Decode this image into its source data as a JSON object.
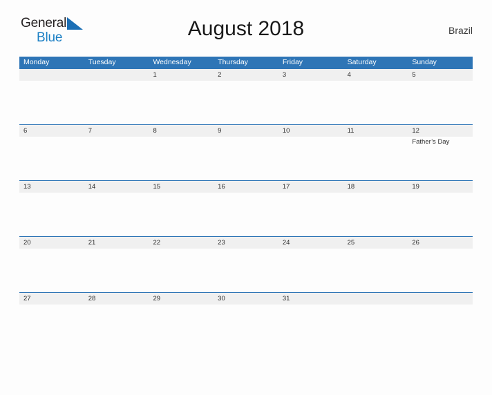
{
  "logo": {
    "text_top": "General",
    "text_bottom": "Blue",
    "mark": "blue-triangle-flag",
    "color_top": "#231f20",
    "color_bottom": "#1b7fc4"
  },
  "header": {
    "title": "August 2018",
    "country": "Brazil"
  },
  "colors": {
    "header_bar": "#2e75b6",
    "date_band": "#f0f0f0",
    "rule": "#2e75b6",
    "page_background": "#fdfdfd",
    "text": "#2b2b2b"
  },
  "calendar": {
    "weekday_headers": [
      "Monday",
      "Tuesday",
      "Wednesday",
      "Thursday",
      "Friday",
      "Saturday",
      "Sunday"
    ],
    "weeks": [
      {
        "days": [
          {
            "num": "",
            "events": []
          },
          {
            "num": "",
            "events": []
          },
          {
            "num": "1",
            "events": []
          },
          {
            "num": "2",
            "events": []
          },
          {
            "num": "3",
            "events": []
          },
          {
            "num": "4",
            "events": []
          },
          {
            "num": "5",
            "events": []
          }
        ]
      },
      {
        "days": [
          {
            "num": "6",
            "events": []
          },
          {
            "num": "7",
            "events": []
          },
          {
            "num": "8",
            "events": []
          },
          {
            "num": "9",
            "events": []
          },
          {
            "num": "10",
            "events": []
          },
          {
            "num": "11",
            "events": []
          },
          {
            "num": "12",
            "events": [
              "Father’s Day"
            ]
          }
        ]
      },
      {
        "days": [
          {
            "num": "13",
            "events": []
          },
          {
            "num": "14",
            "events": []
          },
          {
            "num": "15",
            "events": []
          },
          {
            "num": "16",
            "events": []
          },
          {
            "num": "17",
            "events": []
          },
          {
            "num": "18",
            "events": []
          },
          {
            "num": "19",
            "events": []
          }
        ]
      },
      {
        "days": [
          {
            "num": "20",
            "events": []
          },
          {
            "num": "21",
            "events": []
          },
          {
            "num": "22",
            "events": []
          },
          {
            "num": "23",
            "events": []
          },
          {
            "num": "24",
            "events": []
          },
          {
            "num": "25",
            "events": []
          },
          {
            "num": "26",
            "events": []
          }
        ]
      },
      {
        "days": [
          {
            "num": "27",
            "events": []
          },
          {
            "num": "28",
            "events": []
          },
          {
            "num": "29",
            "events": []
          },
          {
            "num": "30",
            "events": []
          },
          {
            "num": "31",
            "events": []
          },
          {
            "num": "",
            "events": []
          },
          {
            "num": "",
            "events": []
          }
        ]
      }
    ]
  }
}
